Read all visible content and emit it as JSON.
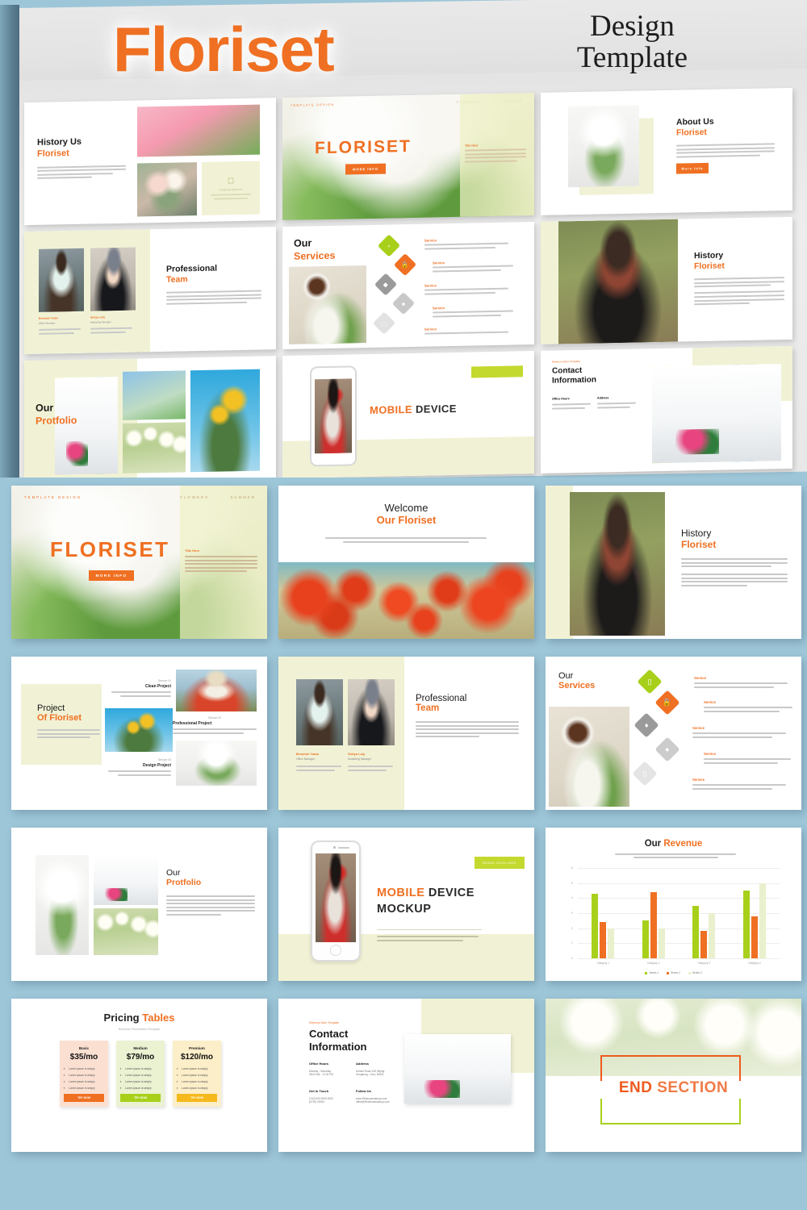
{
  "header": {
    "brand": "Floriset",
    "subtitle_line1": "Design",
    "subtitle_line2": "Template"
  },
  "theme": {
    "background": "#9dc6d8",
    "accent_orange": "#ef7022",
    "accent_green": "#a8d01b",
    "accent_cream": "#f1f2d5",
    "accent_yellow": "#f6b91c",
    "text_dark": "#1a1a1a",
    "gray": "#9e9e9e"
  },
  "lorem": {
    "short": "A wonderful serenity has taken possession of my entire soul, like these sweet mornings.",
    "paragraph": "Most designers set their type arbitrarily, either by pulling values out of the sky adhering. Most designers set their type arbitrarily, either by pulling values.",
    "long": "Most designers set their type arbitrarily, either by pulling values out of the sky adhering. Most designers set their type arbitrarily, either by pulling values out of the sky adhering, type arbitrarily, either by pulling values out of the sky adhering.",
    "ipsum": "Lorem ipsum is simply dummy text of the printing and typesetting industry. Lorem ipsum has been the industry's standard."
  },
  "slides": {
    "title": {
      "eyebrow": "TEMPLATE DESIGN",
      "nav": [
        "FLOWERS",
        "SUMMER"
      ],
      "headline": "FLORISET",
      "button": "MORE INFO",
      "side_title": "Title Here",
      "side_body": "Lorem ipsum is simply dummy text of the printing and typesetting industry. Lorem ipsum has been the industry's standard dummy text ever since."
    },
    "welcome": {
      "line1": "Welcome",
      "line2": "Our Floriset",
      "body": "Most designers set their type arbitrarily, either by pulling values out of the sky adhering. Most designers set their type arbitrarily, either by pulling values out of the sky adhering, type arbitrarily, either by pulling values."
    },
    "history": {
      "line1": "History",
      "line2": "Floriset",
      "para1": "Most designers set their type arbitrarily, either by pulling values out of the sky adhering. Most designers set their type arbitrarily either by pulling values.",
      "para2": "Most designers set their type arbitrarily, either by pulling values out of the sky adhering. Most designers set their type arbitrarily either by pulling values out of the sky adhering, type arbitrarily either by pulling values out of the sky adhering."
    },
    "history_us": {
      "line1": "History Us",
      "line2": "Floriset",
      "badge": "VIDEOGRAPHY"
    },
    "about": {
      "line1": "About Us",
      "line2": "Floriset",
      "button": "More Info"
    },
    "project": {
      "line1": "Project",
      "line2": "Of Floriset",
      "intro": "A wonderful serenity has taken possession of my entire soul, like these sweet mornings.",
      "items": [
        {
          "num": "Service 01",
          "title": "Clean Project",
          "body": "A wonderful serenity has taken possession of my entire soul, like these sweet mornings."
        },
        {
          "num": "Service 02",
          "title": "Professional Project",
          "body": "A wonderful serenity has taken possession of my entire soul, like these sweet mornings."
        },
        {
          "num": "Service 03",
          "title": "Design Project",
          "body": "A wonderful serenity has taken possession of my entire soul, like these sweet mornings."
        }
      ]
    },
    "team": {
      "line1": "Professional",
      "line2": "Team",
      "body": "Most designers set their type arbitrarily, either by pulling values out of the sky adhering. Most designers set their type arbitrarily, either by pulling values out of the sky adhering, type arbitrarily, either by pulling values out of the sky adhering.",
      "members": [
        {
          "name": "Broomie Yutan",
          "role": "Office Manager",
          "note": "Most designers set their type arbitrarily, values."
        },
        {
          "name": "Sintya Luly",
          "role": "Marketing Manager",
          "note": "Most designers set their type arbitrarily, values."
        }
      ]
    },
    "services": {
      "line1": "Our",
      "line2": "Services",
      "items": [
        {
          "label": "Service",
          "icon": "tag-icon",
          "color": "#a8d01b",
          "body": "A wonderful serenity has taken possession of my entire soul, like these sweet mornings."
        },
        {
          "label": "Service",
          "icon": "lock-icon",
          "color": "#ef7022",
          "body": "A wonderful serenity has taken possession of my entire soul, like these sweet mornings."
        },
        {
          "label": "Service",
          "icon": "diamond-icon",
          "color": "#9a9a9a",
          "body": "A wonderful serenity has taken possession of my entire soul, like these sweet mornings."
        },
        {
          "label": "Service",
          "icon": "location-pin-icon",
          "color": "#c8c8c8",
          "body": "A wonderful serenity has taken possession of my entire soul, like these sweet mornings."
        },
        {
          "label": "Service",
          "icon": "monitor-icon",
          "color": "#e2e2e2",
          "body": "A wonderful serenity has taken possession of my entire soul, like these sweet mornings."
        }
      ]
    },
    "portfolio": {
      "line1": "Our",
      "line2": "Protfolio",
      "body": "Most designers set their type arbitrarily either by pulling values out of the sky adhering. Most designers set their type arbitrarily, either by pulling values out of the sky adhering, type arbitrarily either by pulling values out of the sky adhering."
    },
    "mobile": {
      "badge": "BRAND GUIDLINES",
      "title_orange": "MOBILE",
      "title_dark": " DEVICE",
      "title_line2": "MOCKUP",
      "body": "Lorem ipsum is simply dummy text of the printing and typesetting industry. Lorem ipsum has been the industry's standard."
    },
    "revenue": {
      "title_dark": "Our ",
      "title_orange": "Revenue",
      "subtitle": "Vestibulum ac diam sit amet quam vehicula elementum sed sit amet dui."
    },
    "pricing": {
      "title_dark": "Pricing ",
      "title_orange": "Tables",
      "subtitle": "Business Presentation Template",
      "plans": [
        {
          "name": "Basic",
          "price": "$35/mo",
          "card_color": "#fbe0d2",
          "btn_color": "#ef7022",
          "btn_label": "TRY NOW",
          "features": [
            "Lorem ipsum is simply",
            "Lorem ipsum is simply",
            "Lorem ipsum is simply",
            "Lorem ipsum is simply"
          ]
        },
        {
          "name": "Medium",
          "price": "$79/mo",
          "card_color": "#eaf2d2",
          "btn_color": "#a8d01b",
          "btn_label": "TRY NOW",
          "features": [
            "Lorem ipsum is simply",
            "Lorem ipsum is simply",
            "Lorem ipsum is simply",
            "Lorem ipsum is simply"
          ]
        },
        {
          "name": "Premium",
          "price": "$120/mo",
          "card_color": "#fceec8",
          "btn_color": "#f6b91c",
          "btn_label": "TRY NOW",
          "features": [
            "Lorem ipsum is simply",
            "Lorem ipsum is simply",
            "Lorem ipsum is simply",
            "Lorem ipsum is simply"
          ]
        }
      ]
    },
    "contact": {
      "eyebrow": "Rebecca Store Template",
      "line1": "Contact",
      "line2": "Information",
      "blocks": [
        {
          "heading": "Office Hours",
          "l1": "Monday - Saturday",
          "l2": "08.00 AM - 12.00 PM"
        },
        {
          "heading": "Address",
          "l1": "Sunset Road 108, Bejing",
          "l2": "Hongkong - Cina, 54531"
        },
        {
          "heading": "Get In Touch",
          "l1": "(+62) 000 0000 0000",
          "l2": "(0720) 00000"
        },
        {
          "heading": "Follow Us",
          "l1": "www.Rebeccamakeup.com",
          "l2": "office@Rebeccamakeup.com"
        }
      ]
    },
    "end": {
      "word_orange": "END",
      "word_dark": " SECTION"
    }
  },
  "chart_data": {
    "type": "bar",
    "title": "Our Revenue",
    "subtitle": "Vestibulum ac diam sit amet quam vehicula elementum sed sit amet dui.",
    "categories": [
      "Category 1",
      "Category 2",
      "Category 3",
      "Category 4"
    ],
    "series": [
      {
        "name": "Series 1",
        "color": "#a8d01b",
        "values": [
          4.3,
          2.5,
          3.5,
          4.5
        ]
      },
      {
        "name": "Series 2",
        "color": "#ef7022",
        "values": [
          2.4,
          4.4,
          1.8,
          2.8
        ]
      },
      {
        "name": "Series 3",
        "color": "#e9f0cd",
        "values": [
          2.0,
          2.0,
          3.0,
          5.0
        ]
      }
    ],
    "yticks": [
      0,
      1,
      2,
      3,
      4,
      5,
      6
    ],
    "ylim": [
      0,
      6
    ],
    "xlabel": "",
    "ylabel": "",
    "grid": true,
    "legend_position": "bottom"
  }
}
